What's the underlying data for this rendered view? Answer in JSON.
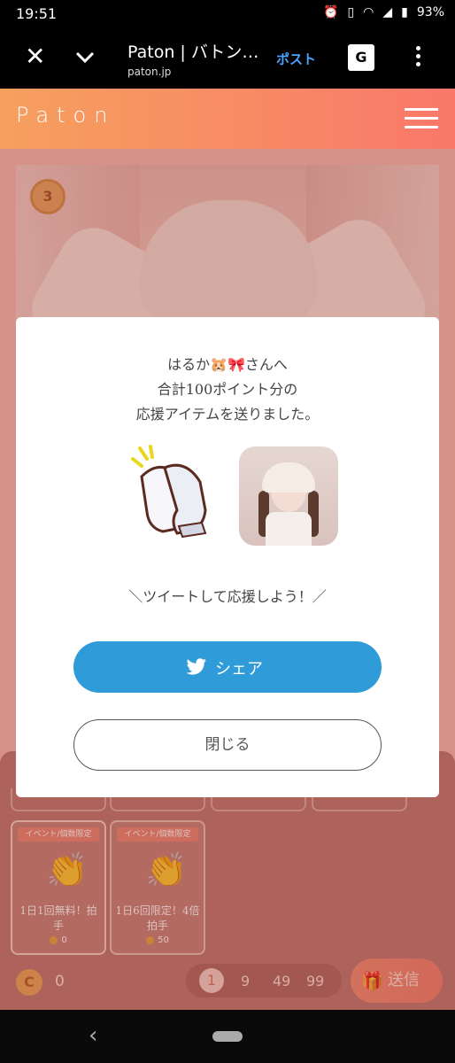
{
  "status_bar": {
    "time": "19:51",
    "battery": "93%"
  },
  "browser": {
    "title": "Paton | バトン…",
    "url": "paton.jp",
    "post_label": "ポスト",
    "translate_label": "G"
  },
  "app": {
    "logo": "Paton"
  },
  "profile": {
    "rank": "3"
  },
  "modal": {
    "message_line1": "はるか🐹🎀さんへ",
    "message_line2": "合計100ポイント分の",
    "message_line3": "応援アイテムを送りました。",
    "cheer": "＼ツイートして応援しよう！／",
    "share_label": "シェア",
    "close_label": "閉じる"
  },
  "items": [
    {
      "tag": "イベント/個数限定",
      "label": "1日1回無料！拍手",
      "cost": "0"
    },
    {
      "tag": "イベント/個数限定",
      "label": "1日6回限定！4倍拍手",
      "cost": "50"
    }
  ],
  "footer": {
    "coin_symbol": "C",
    "balance": "0",
    "quantities": [
      "1",
      "9",
      "49",
      "99"
    ],
    "send_label": "送信"
  },
  "colors": {
    "accent": "#f07a68",
    "twitter": "#2f9bd8",
    "header_start": "#f6a05e",
    "header_end": "#f9786a"
  }
}
